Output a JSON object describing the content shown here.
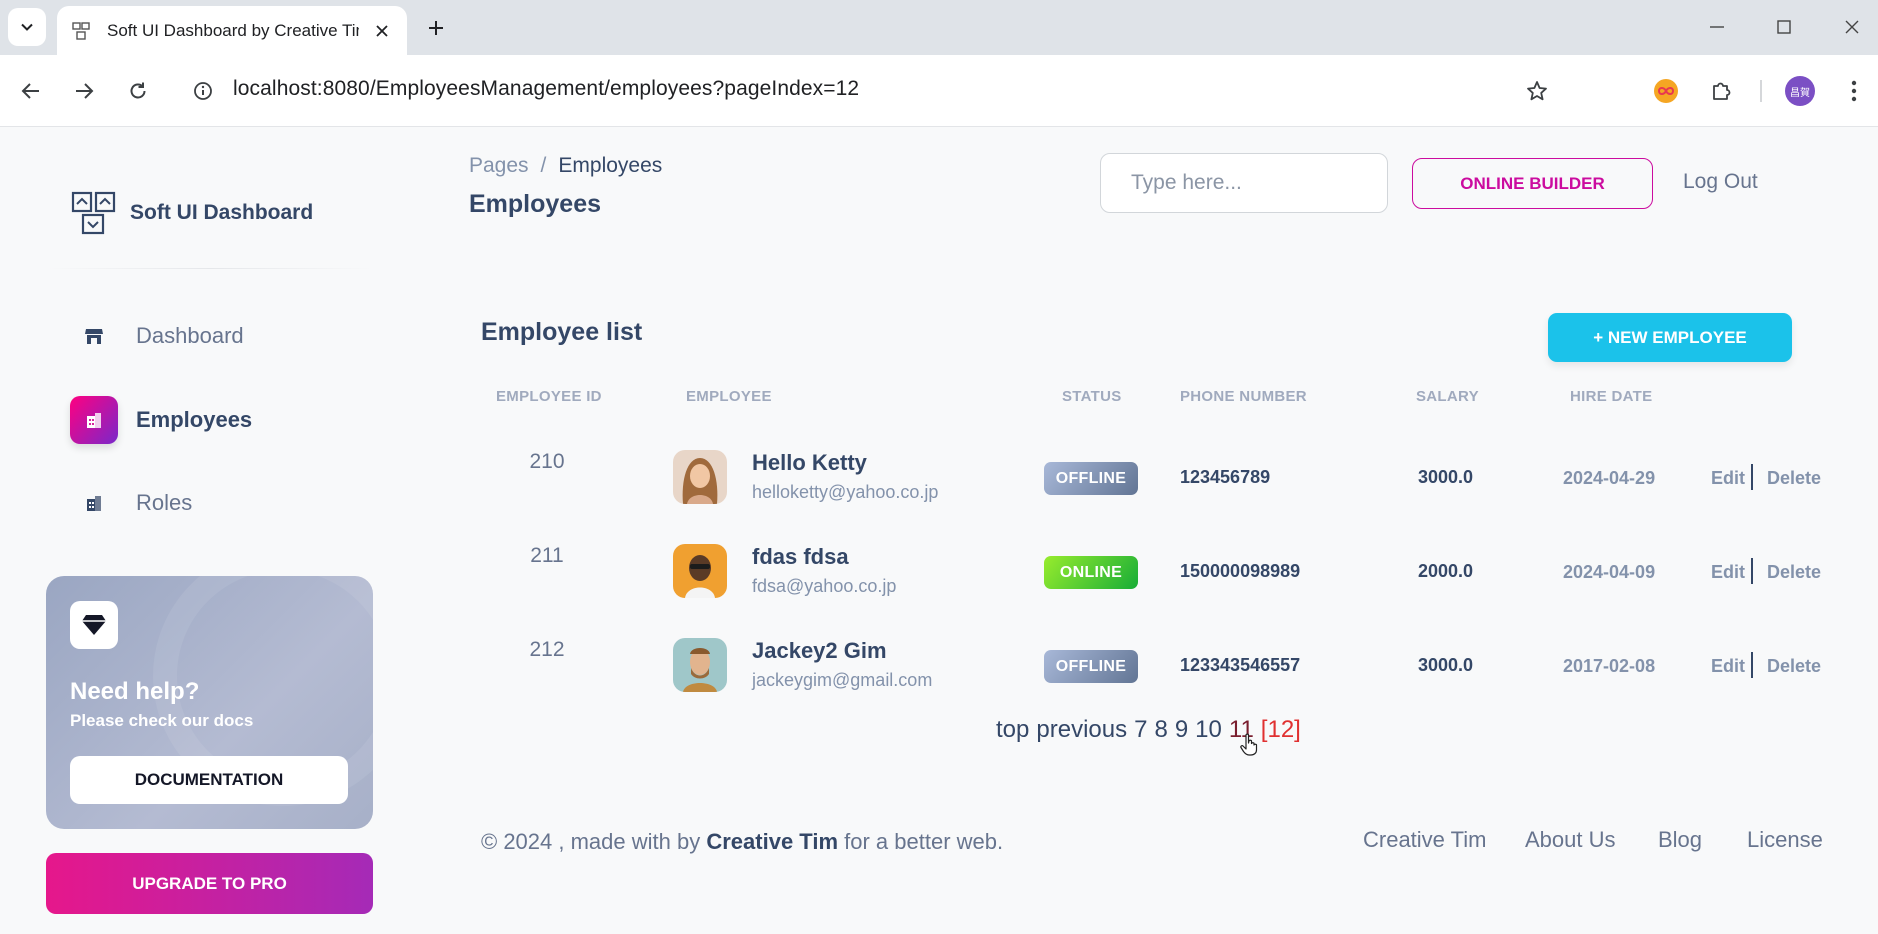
{
  "browser": {
    "tab_title": "Soft UI Dashboard by Creative Tim",
    "url": "localhost:8080/EmployeesManagement/employees?pageIndex=12",
    "profile_initials": "昌賀"
  },
  "sidebar": {
    "brand": "Soft UI Dashboard",
    "items": [
      {
        "label": "Dashboard",
        "icon": "shop-icon"
      },
      {
        "label": "Employees",
        "icon": "office-icon"
      },
      {
        "label": "Roles",
        "icon": "office-icon"
      }
    ],
    "help": {
      "title": "Need help?",
      "subtitle": "Please check our docs",
      "button": "DOCUMENTATION"
    },
    "upgrade": "UPGRADE TO PRO"
  },
  "header": {
    "breadcrumb_parent": "Pages",
    "breadcrumb_sep": "/",
    "breadcrumb_current": "Employees",
    "title": "Employees",
    "search_placeholder": "Type here...",
    "online_builder": "ONLINE BUILDER",
    "logout": "Log Out"
  },
  "card": {
    "title": "Employee list",
    "new_button": "+ NEW EMPLOYEE",
    "columns": [
      "EMPLOYEE ID",
      "EMPLOYEE",
      "STATUS",
      "PHONE NUMBER",
      "SALARY",
      "HIRE DATE"
    ],
    "rows": [
      {
        "id": "210",
        "name": "Hello Ketty",
        "email": "helloketty@yahoo.co.jp",
        "status": "OFFLINE",
        "phone": "123456789",
        "salary": "3000.0",
        "hire_date": "2024-04-29",
        "edit": "Edit",
        "delete": "Delete"
      },
      {
        "id": "211",
        "name": "fdas fdsa",
        "email": "fdsa@yahoo.co.jp",
        "status": "ONLINE",
        "phone": "150000098989",
        "salary": "2000.0",
        "hire_date": "2024-04-09",
        "edit": "Edit",
        "delete": "Delete"
      },
      {
        "id": "212",
        "name": "Jackey2 Gim",
        "email": "jackeygim@gmail.com",
        "status": "OFFLINE",
        "phone": "123343546557",
        "salary": "3000.0",
        "hire_date": "2017-02-08",
        "edit": "Edit",
        "delete": "Delete"
      }
    ]
  },
  "pagination": {
    "top": "top",
    "previous": "previous",
    "pages": [
      "7",
      "8",
      "9",
      "10",
      "11"
    ],
    "current": "[12]"
  },
  "footer": {
    "prefix": "© 2024 , made with by",
    "author": "Creative Tim",
    "suffix": "for a better web.",
    "links": [
      "Creative Tim",
      "About Us",
      "Blog",
      "License"
    ]
  },
  "colors": {
    "accent": "#cb0c9f",
    "info": "#1bc2ea",
    "online": "#17ad37",
    "offline": "#627594"
  }
}
